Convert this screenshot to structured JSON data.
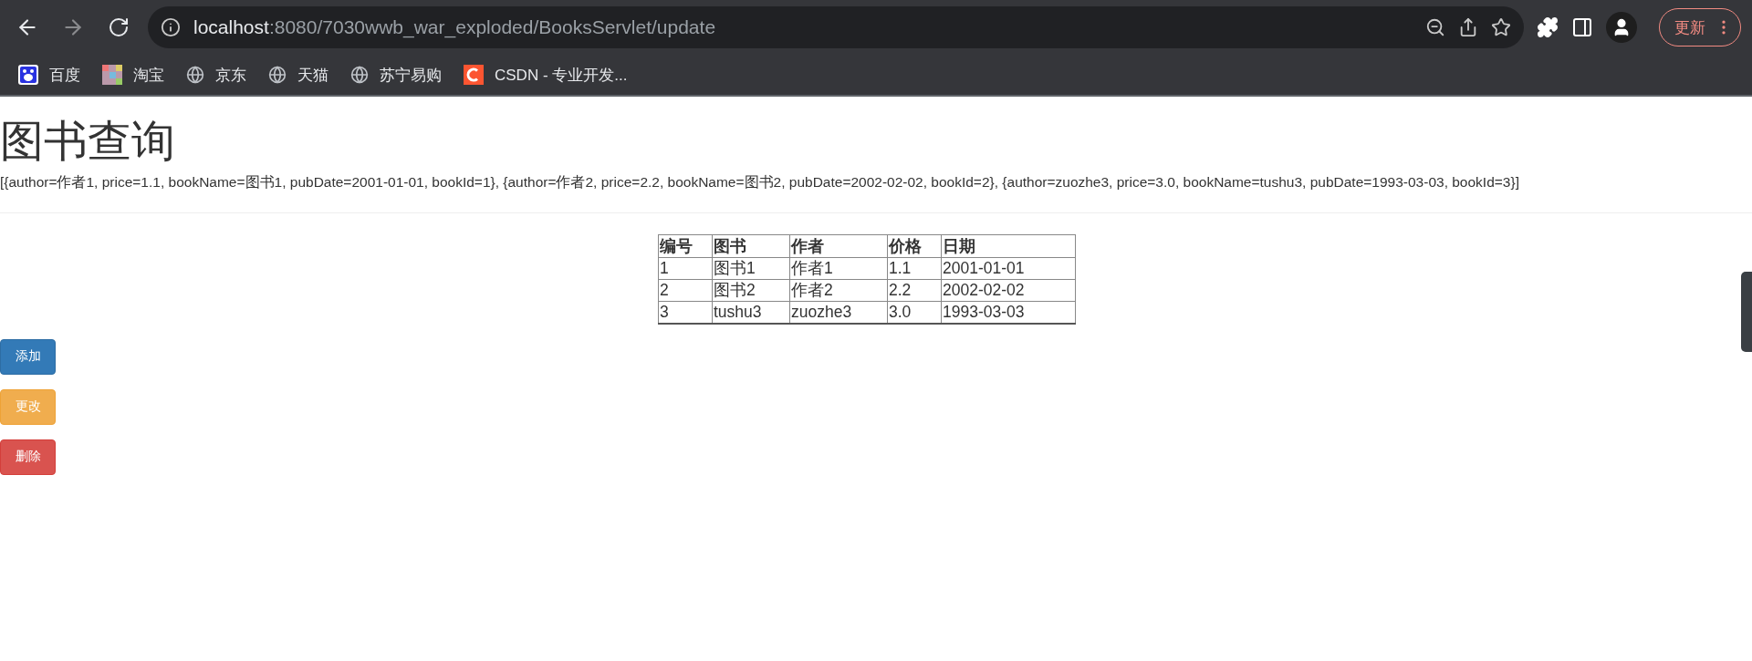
{
  "browser": {
    "url_host": "localhost",
    "url_path": ":8080/7030wwb_war_exploded/BooksServlet/update",
    "update_button": "更新",
    "bookmarks": [
      {
        "label": "百度",
        "kind": "baidu"
      },
      {
        "label": "淘宝",
        "kind": "taobao"
      },
      {
        "label": "京东",
        "kind": "globe"
      },
      {
        "label": "天猫",
        "kind": "globe"
      },
      {
        "label": "苏宁易购",
        "kind": "globe"
      },
      {
        "label": "CSDN - 专业开发...",
        "kind": "csdn"
      }
    ]
  },
  "page": {
    "title": "图书查询",
    "data_dump": "[{author=作者1, price=1.1, bookName=图书1, pubDate=2001-01-01, bookId=1}, {author=作者2, price=2.2, bookName=图书2, pubDate=2002-02-02, bookId=2}, {author=zuozhe3, price=3.0, bookName=tushu3, pubDate=1993-03-03, bookId=3}]",
    "table": {
      "columns": [
        "编号",
        "图书",
        "作者",
        "价格",
        "日期"
      ],
      "rows": [
        [
          "1",
          "图书1",
          "作者1",
          "1.1",
          "2001-01-01"
        ],
        [
          "2",
          "图书2",
          "作者2",
          "2.2",
          "2002-02-02"
        ],
        [
          "3",
          "tushu3",
          "zuozhe3",
          "3.0",
          "1993-03-03"
        ]
      ]
    },
    "buttons": [
      {
        "label": "添加",
        "kind": "primary"
      },
      {
        "label": "更改",
        "kind": "warning"
      },
      {
        "label": "删除",
        "kind": "danger"
      }
    ]
  }
}
